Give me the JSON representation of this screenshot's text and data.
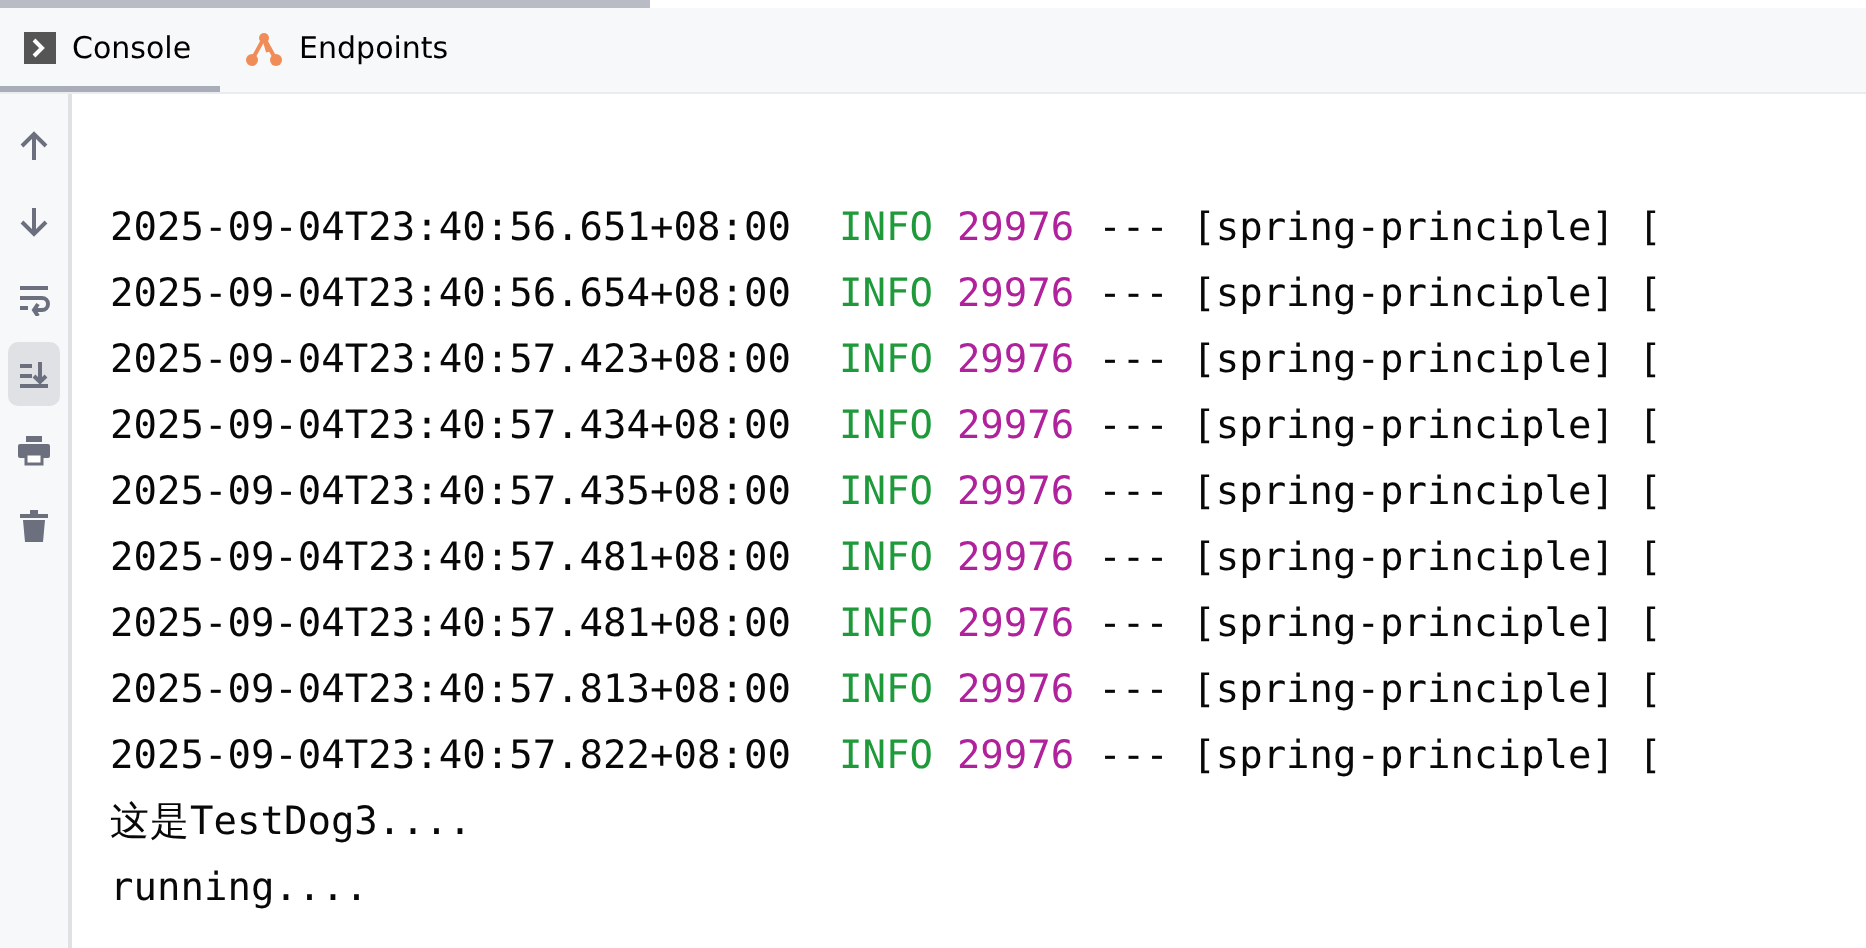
{
  "tabs": [
    {
      "label": "Console",
      "kind": "console",
      "selected": true
    },
    {
      "label": "Endpoints",
      "kind": "endpoints",
      "selected": false
    }
  ],
  "toolbar": [
    {
      "kind": "up",
      "selected": false
    },
    {
      "kind": "down",
      "selected": false
    },
    {
      "kind": "wrap",
      "selected": false
    },
    {
      "kind": "scroll-end",
      "selected": true
    },
    {
      "kind": "print",
      "selected": false
    },
    {
      "kind": "trash",
      "selected": false
    }
  ],
  "log_lines": [
    {
      "timestamp": "2025-09-04T23:40:56.651+08:00",
      "level": "INFO",
      "pid": "29976",
      "rest": "--- [spring-principle] ["
    },
    {
      "timestamp": "2025-09-04T23:40:56.654+08:00",
      "level": "INFO",
      "pid": "29976",
      "rest": "--- [spring-principle] ["
    },
    {
      "timestamp": "2025-09-04T23:40:57.423+08:00",
      "level": "INFO",
      "pid": "29976",
      "rest": "--- [spring-principle] ["
    },
    {
      "timestamp": "2025-09-04T23:40:57.434+08:00",
      "level": "INFO",
      "pid": "29976",
      "rest": "--- [spring-principle] ["
    },
    {
      "timestamp": "2025-09-04T23:40:57.435+08:00",
      "level": "INFO",
      "pid": "29976",
      "rest": "--- [spring-principle] ["
    },
    {
      "timestamp": "2025-09-04T23:40:57.481+08:00",
      "level": "INFO",
      "pid": "29976",
      "rest": "--- [spring-principle] ["
    },
    {
      "timestamp": "2025-09-04T23:40:57.481+08:00",
      "level": "INFO",
      "pid": "29976",
      "rest": "--- [spring-principle] ["
    },
    {
      "timestamp": "2025-09-04T23:40:57.813+08:00",
      "level": "INFO",
      "pid": "29976",
      "rest": "--- [spring-principle] ["
    },
    {
      "timestamp": "2025-09-04T23:40:57.822+08:00",
      "level": "INFO",
      "pid": "29976",
      "rest": "--- [spring-principle] ["
    }
  ],
  "output_lines": [
    "这是TestDog3....",
    "running...."
  ]
}
